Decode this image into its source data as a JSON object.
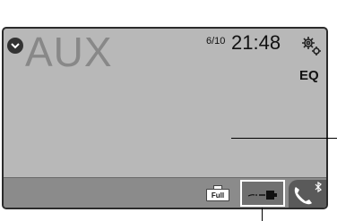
{
  "source": {
    "label": "AUX",
    "toggle_icon": "chevron-down-icon"
  },
  "status": {
    "date": "6/10",
    "time": "21:48"
  },
  "controls": {
    "settings_icon": "gear-icon",
    "eq_label": "EQ"
  },
  "bottom_bar": {
    "battery_label": "Full",
    "battery_icon": "battery-icon",
    "device_icon": "aux-cable-icon",
    "phone_icon": "phone-icon",
    "bluetooth_icon": "bluetooth-icon"
  },
  "colors": {
    "screen_bg": "#b8b8b8",
    "bar_bg": "#8b8b8b",
    "source_text": "#888888"
  }
}
